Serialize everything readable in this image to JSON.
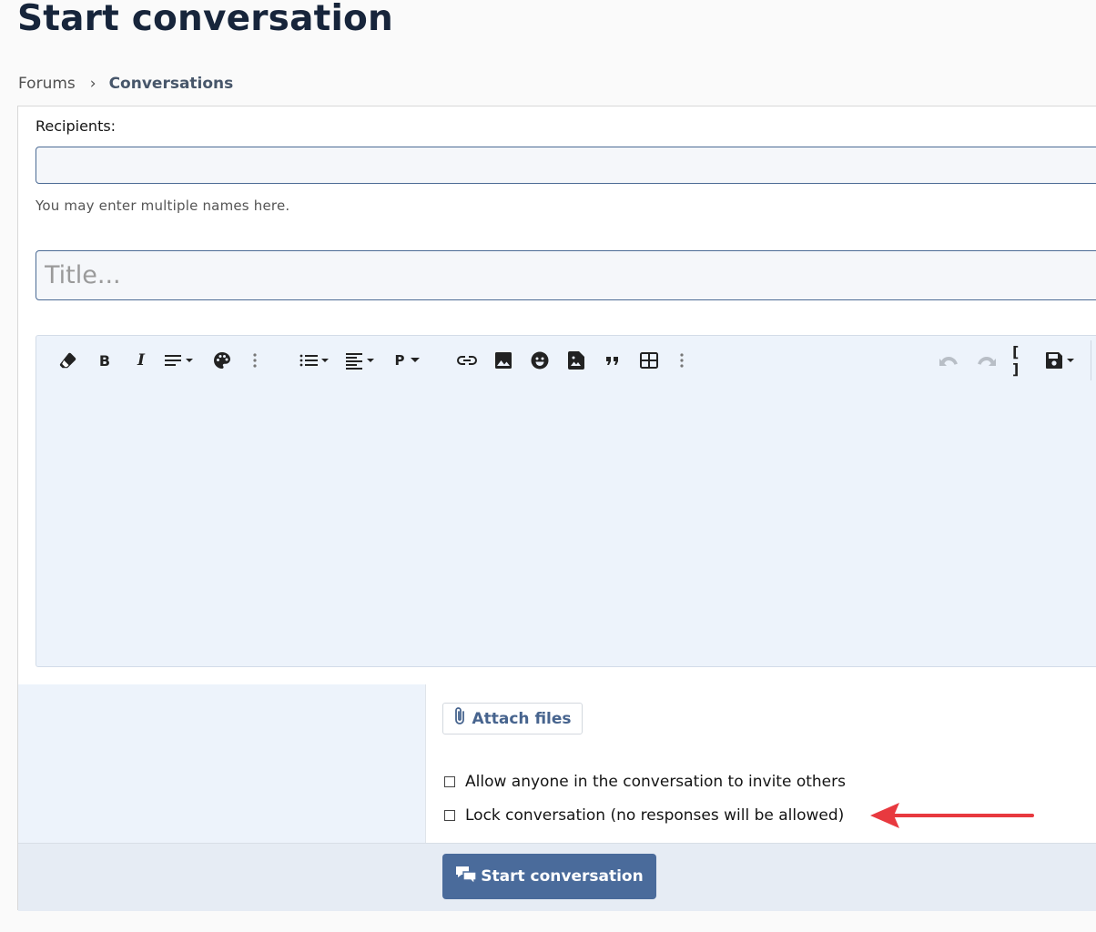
{
  "page": {
    "title": "Start conversation"
  },
  "breadcrumb": {
    "items": [
      "Forums",
      "Conversations"
    ],
    "separator": "›"
  },
  "form": {
    "recipients_label": "Recipients:",
    "recipients_value": "",
    "recipients_hint": "You may enter multiple names here.",
    "title_placeholder": "Title...",
    "title_value": ""
  },
  "editor": {
    "toolbar": [
      "eraser-icon",
      "bold-icon",
      "italic-icon",
      "text-style-dropdown",
      "palette-icon",
      "more-vertical-icon",
      "list-dropdown",
      "align-dropdown",
      "paragraph-dropdown",
      "link-icon",
      "image-icon",
      "smiley-icon",
      "media-icon",
      "quote-icon",
      "table-icon",
      "more-vertical-icon",
      "undo-icon",
      "redo-icon",
      "bbcode-toggle-icon",
      "save-draft-dropdown"
    ],
    "paragraph_label": "P",
    "background": "#edf3fb"
  },
  "attachments": {
    "button_label": "Attach files"
  },
  "options": {
    "invite_label": "Allow anyone in the conversation to invite others",
    "lock_label": "Lock conversation (no responses will be allowed)",
    "invite_checked": false,
    "lock_checked": false
  },
  "submit": {
    "label": "Start conversation",
    "color": "#4a6b9b"
  },
  "annotation": {
    "arrow_color": "#e8393f"
  },
  "colors": {
    "heading": "#17253b",
    "accent": "#47648e",
    "input_border": "#4c6b95"
  }
}
